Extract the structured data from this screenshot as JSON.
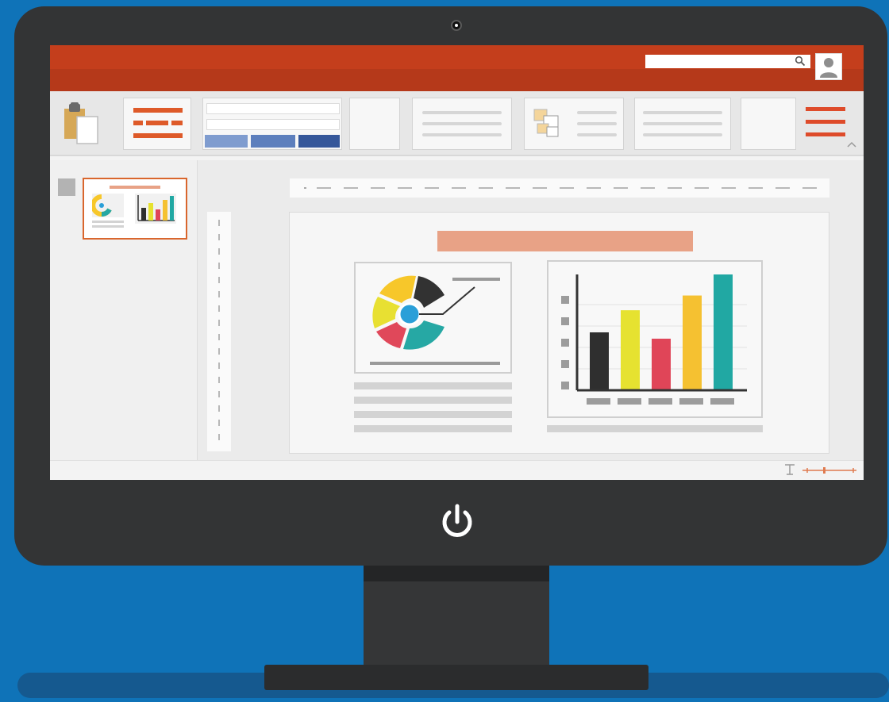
{
  "colors": {
    "background": "#0f73b8",
    "monitor": "#333435",
    "titlebar": "#c43e1c",
    "accent": "#d9662d",
    "slide_title": "#e8a286"
  },
  "window": {
    "search": {
      "placeholder": "",
      "value": "",
      "icon": "search-icon"
    },
    "account_icon": "user-icon"
  },
  "ribbon": {
    "groups": [
      {
        "icon": "clipboard-paste-icon"
      },
      {
        "icon": "layout-icon"
      },
      {
        "icon": "font-style-swatches-icon",
        "swatches": [
          "#7f9ccf",
          "#5d7fbd",
          "#35579a"
        ]
      },
      {
        "icon": "blank-group-icon"
      },
      {
        "icon": "paragraph-icon"
      },
      {
        "icon": "arrange-shapes-icon"
      },
      {
        "icon": "drawing-icon"
      },
      {
        "icon": "blank-group-icon"
      },
      {
        "icon": "menu-icon"
      }
    ],
    "collapse_icon": "chevron-up-icon"
  },
  "thumbnails": [
    {
      "icon": "slide-thumbnail-icon",
      "selected": true
    }
  ],
  "slide": {
    "pie_icon": "donut-chart-icon",
    "pie_segments": [
      {
        "color": "#f7c72a"
      },
      {
        "color": "#323232"
      },
      {
        "color": "#26a8a4"
      },
      {
        "color": "#e0485a"
      },
      {
        "color": "#e8e032"
      }
    ],
    "chart_icon": "bar-chart-icon"
  },
  "chart_data": {
    "type": "bar",
    "categories": [
      "",
      "",
      "",
      "",
      "",
      ""
    ],
    "values": [
      55,
      76,
      49,
      90,
      110,
      0
    ],
    "colors": [
      "#2f2f2f",
      "#e6e230",
      "#e04558",
      "#f5c131",
      "#21a8a3"
    ],
    "title": "",
    "xlabel": "",
    "ylabel": "",
    "ylim": [
      0,
      110
    ],
    "grid": true
  },
  "statusbar": {
    "zoom_icon": "zoom-slider-icon"
  },
  "hardware": {
    "power_icon": "power-icon",
    "camera_icon": "webcam-icon"
  }
}
